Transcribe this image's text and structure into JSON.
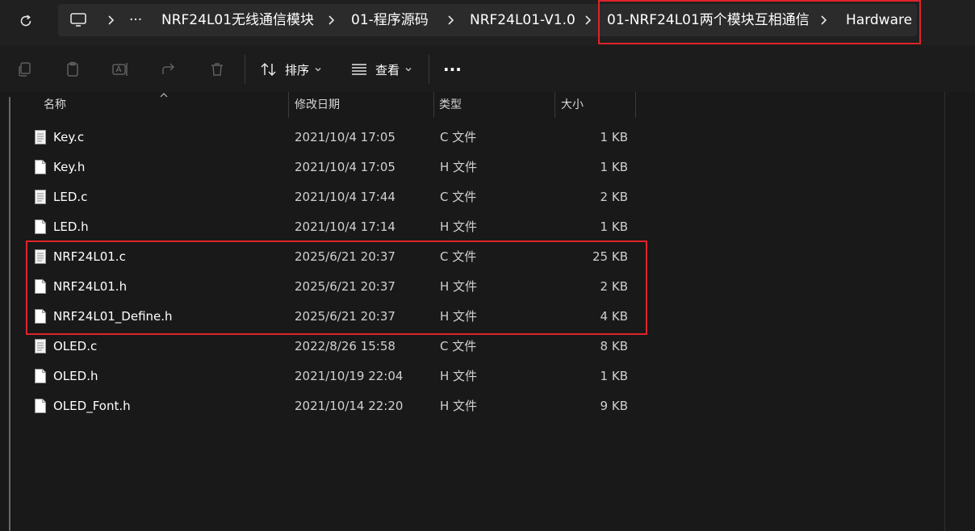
{
  "address": {
    "more": "···",
    "crumbs": [
      "NRF24L01无线通信模块",
      "01-程序源码",
      "NRF24L01-V1.0",
      "01-NRF24L01两个模块互相通信",
      "Hardware"
    ]
  },
  "toolbar": {
    "sort_label": "排序",
    "view_label": "查看",
    "more_label": "···"
  },
  "columns": {
    "name": "名称",
    "modified": "修改日期",
    "type": "类型",
    "size": "大小"
  },
  "files": [
    {
      "name": "Key.c",
      "modified": "2021/10/4 17:05",
      "type": "C 文件",
      "size": "1 KB"
    },
    {
      "name": "Key.h",
      "modified": "2021/10/4 17:05",
      "type": "H 文件",
      "size": "1 KB"
    },
    {
      "name": "LED.c",
      "modified": "2021/10/4 17:44",
      "type": "C 文件",
      "size": "2 KB"
    },
    {
      "name": "LED.h",
      "modified": "2021/10/4 17:14",
      "type": "H 文件",
      "size": "1 KB"
    },
    {
      "name": "NRF24L01.c",
      "modified": "2025/6/21 20:37",
      "type": "C 文件",
      "size": "25 KB"
    },
    {
      "name": "NRF24L01.h",
      "modified": "2025/6/21 20:37",
      "type": "H 文件",
      "size": "2 KB"
    },
    {
      "name": "NRF24L01_Define.h",
      "modified": "2025/6/21 20:37",
      "type": "H 文件",
      "size": "4 KB"
    },
    {
      "name": "OLED.c",
      "modified": "2022/8/26 15:58",
      "type": "C 文件",
      "size": "8 KB"
    },
    {
      "name": "OLED.h",
      "modified": "2021/10/19 22:04",
      "type": "H 文件",
      "size": "1 KB"
    },
    {
      "name": "OLED_Font.h",
      "modified": "2021/10/14 22:20",
      "type": "H 文件",
      "size": "9 KB"
    }
  ],
  "colors": {
    "highlight": "#e0232b",
    "background": "#191919"
  }
}
